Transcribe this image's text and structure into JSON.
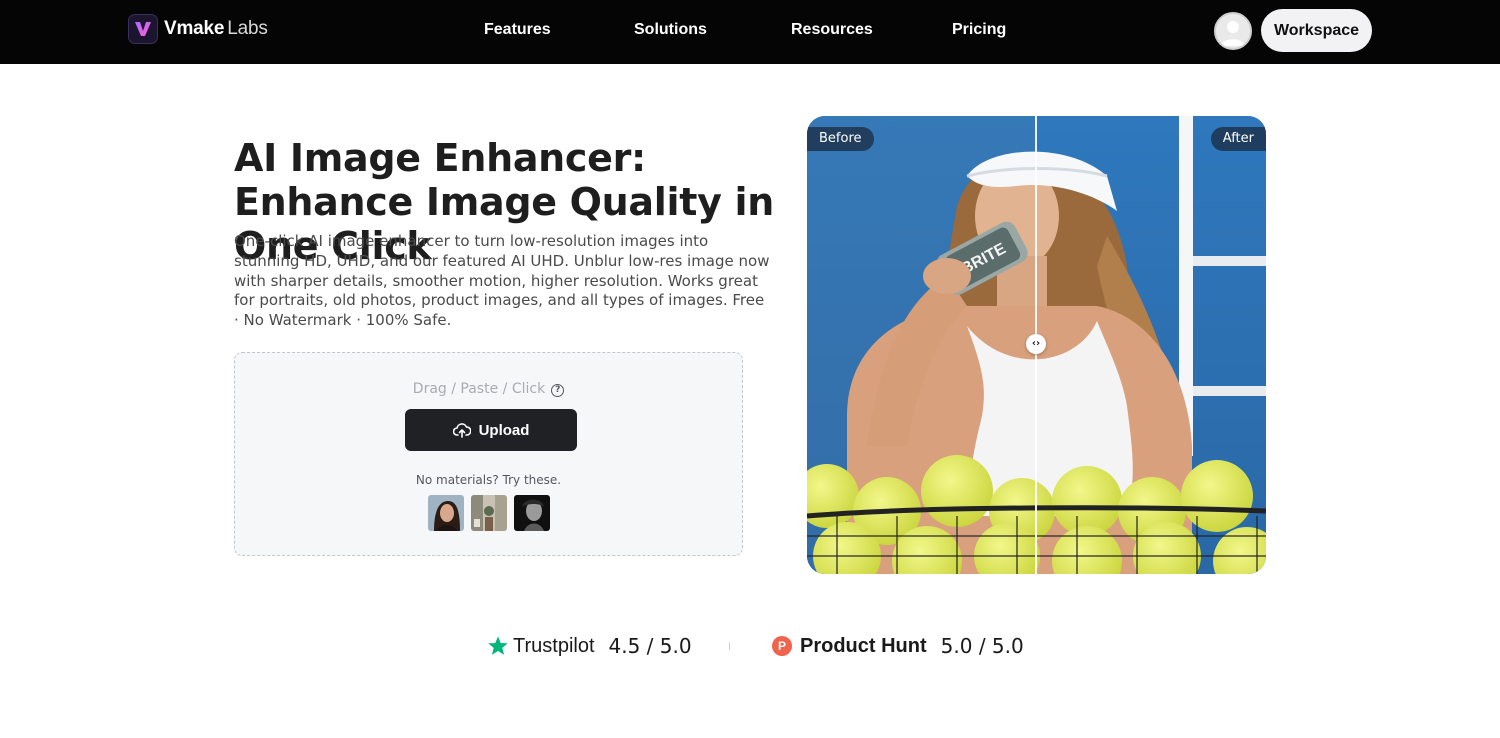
{
  "header": {
    "brand": "Vmake",
    "brand_suffix": "Labs",
    "nav": [
      "Features",
      "Solutions",
      "Resources",
      "Pricing"
    ],
    "workspace_label": "Workspace"
  },
  "hero": {
    "title": "AI Image Enhancer: Enhance Image Quality in One Click",
    "description": "One-click AI image enhancer to turn low-resolution images into stunning HD, UHD, and our featured AI UHD. Unblur low-res image now with sharper details, smoother motion, higher resolution. Works great for portraits, old photos, product images, and all types of images. Free · No Watermark · 100% Safe."
  },
  "upload": {
    "hint": "Drag / Paste / Click",
    "button_label": "Upload",
    "try_text": "No materials? Try these."
  },
  "compare": {
    "before_label": "Before",
    "after_label": "After",
    "can_text": "BRITE"
  },
  "ratings": {
    "trustpilot_name": "Trustpilot",
    "trustpilot_score": "4.5 / 5.0",
    "producthunt_badge": "P",
    "producthunt_name": "Product Hunt",
    "producthunt_score": "5.0 / 5.0"
  },
  "colors": {
    "header_bg": "#050505",
    "upload_button": "#202124",
    "trustpilot_star": "#00b67a",
    "producthunt": "#f0634d"
  }
}
